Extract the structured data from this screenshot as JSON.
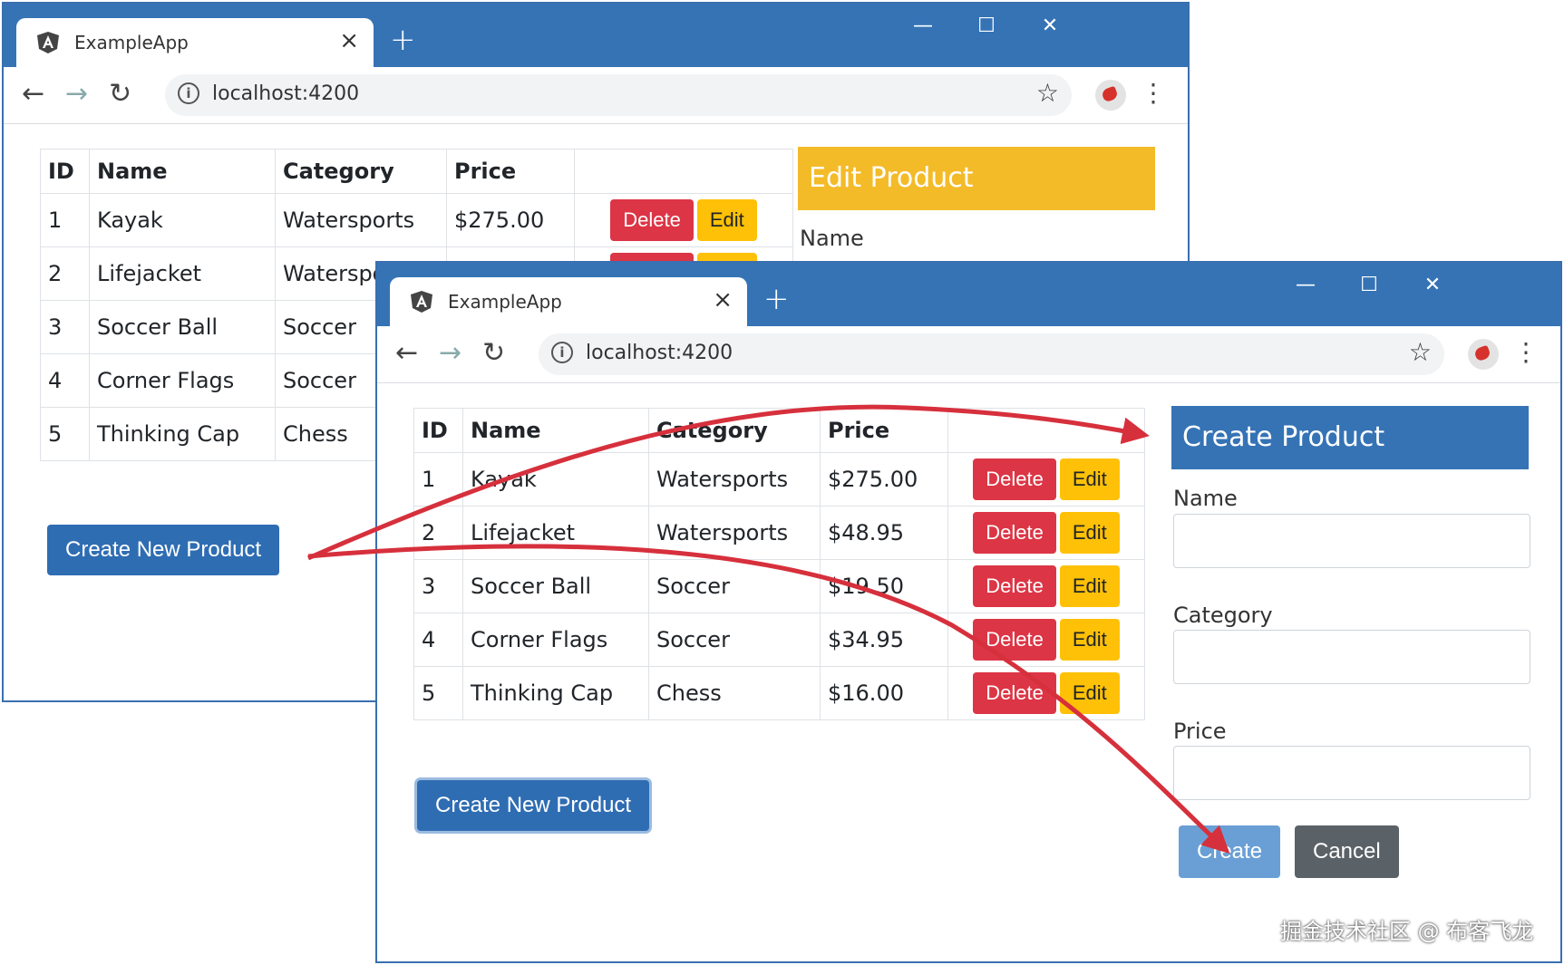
{
  "colors": {
    "titlebar": "#3573b5",
    "primary": "#2f6db3",
    "danger": "#dc3545",
    "warning": "#ffc107",
    "secondary": "#5a6268"
  },
  "window_back": {
    "tab_title": "ExampleApp",
    "tab_close": "×",
    "new_tab": "+",
    "url": "localhost:4200",
    "headers": [
      "ID",
      "Name",
      "Category",
      "Price"
    ],
    "rows": [
      {
        "id": "1",
        "name": "Kayak",
        "category": "Watersports",
        "price": "$275.00"
      },
      {
        "id": "2",
        "name": "Lifejacket",
        "category": "Watersports",
        "price": ""
      },
      {
        "id": "3",
        "name": "Soccer Ball",
        "category": "Soccer",
        "price": ""
      },
      {
        "id": "4",
        "name": "Corner Flags",
        "category": "Soccer",
        "price": ""
      },
      {
        "id": "5",
        "name": "Thinking Cap",
        "category": "Chess",
        "price": ""
      }
    ],
    "delete_label": "Delete",
    "edit_label": "Edit",
    "create_new_label": "Create New Product",
    "form_title": "Edit Product",
    "form_name_label": "Name"
  },
  "window_front": {
    "tab_title": "ExampleApp",
    "tab_close": "×",
    "new_tab": "+",
    "url": "localhost:4200",
    "headers": [
      "ID",
      "Name",
      "Category",
      "Price"
    ],
    "rows": [
      {
        "id": "1",
        "name": "Kayak",
        "category": "Watersports",
        "price": "$275.00"
      },
      {
        "id": "2",
        "name": "Lifejacket",
        "category": "Watersports",
        "price": "$48.95"
      },
      {
        "id": "3",
        "name": "Soccer Ball",
        "category": "Soccer",
        "price": "$19.50"
      },
      {
        "id": "4",
        "name": "Corner Flags",
        "category": "Soccer",
        "price": "$34.95"
      },
      {
        "id": "5",
        "name": "Thinking Cap",
        "category": "Chess",
        "price": "$16.00"
      }
    ],
    "delete_label": "Delete",
    "edit_label": "Edit",
    "create_new_label": "Create New Product",
    "form_title": "Create Product",
    "name_label": "Name",
    "category_label": "Category",
    "price_label": "Price",
    "create_label": "Create",
    "cancel_label": "Cancel"
  },
  "watermark": "掘金技术社区 @ 布客飞龙"
}
